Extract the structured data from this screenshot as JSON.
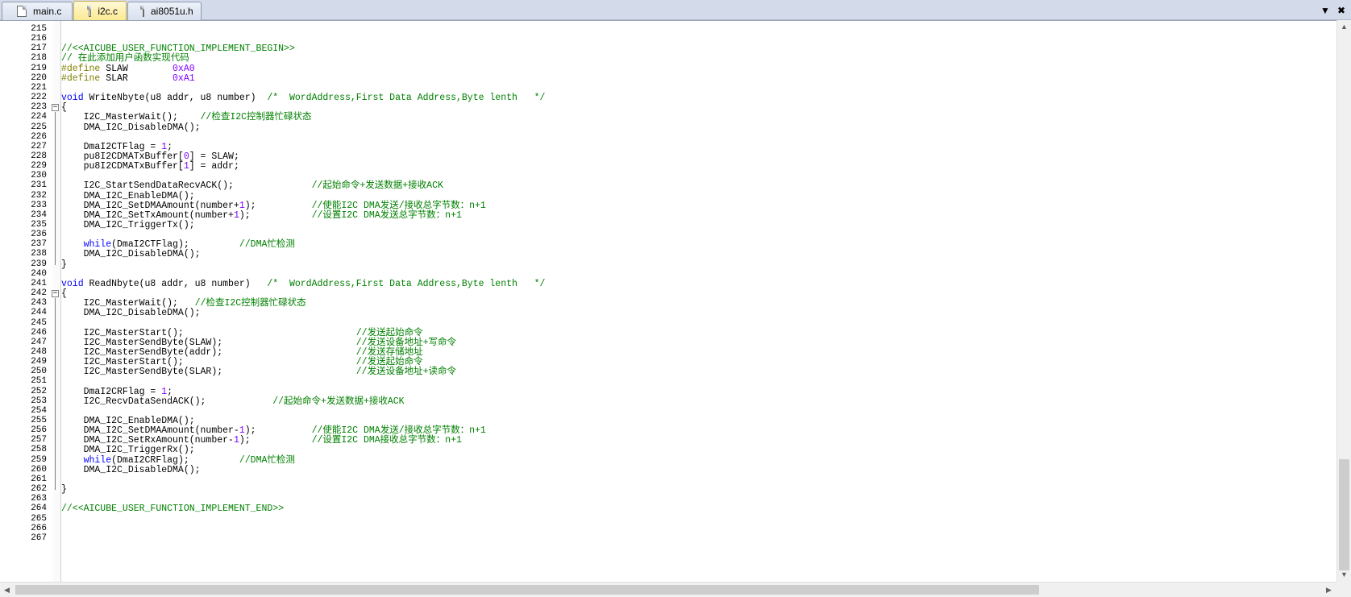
{
  "tabs": [
    {
      "label": "main.c",
      "active": false
    },
    {
      "label": "i2c.c",
      "active": true
    },
    {
      "label": "ai8051u.h",
      "active": false
    }
  ],
  "tab_controls": {
    "dropdown": "▼",
    "close": "✖"
  },
  "scrollbars": {
    "up": "▲",
    "down": "▼",
    "left": "◀",
    "right": "▶"
  },
  "code": [
    {
      "n": "215",
      "tokens": []
    },
    {
      "n": "216",
      "tokens": []
    },
    {
      "n": "217",
      "tokens": [
        [
          "comment",
          "//<<AICUBE_USER_FUNCTION_IMPLEMENT_BEGIN>>"
        ]
      ]
    },
    {
      "n": "218",
      "tokens": [
        [
          "comment",
          "// 在此添加用户函数实现代码"
        ]
      ]
    },
    {
      "n": "219",
      "tokens": [
        [
          "pre",
          "#define"
        ],
        [
          "text",
          " SLAW        "
        ],
        [
          "num",
          "0xA0"
        ]
      ]
    },
    {
      "n": "220",
      "tokens": [
        [
          "pre",
          "#define"
        ],
        [
          "text",
          " SLAR        "
        ],
        [
          "num",
          "0xA1"
        ]
      ]
    },
    {
      "n": "221",
      "tokens": []
    },
    {
      "n": "222",
      "tokens": [
        [
          "keyword",
          "void"
        ],
        [
          "text",
          " WriteNbyte(u8 addr, u8 number)  "
        ],
        [
          "comment",
          "/*  WordAddress,First Data Address,Byte lenth   */"
        ]
      ]
    },
    {
      "n": "223",
      "tokens": [
        [
          "text",
          "{"
        ]
      ],
      "fold": "open"
    },
    {
      "n": "224",
      "tokens": [
        [
          "text",
          "    I2C_MasterWait();    "
        ],
        [
          "comment",
          "//检查I2C控制器忙碌状态"
        ]
      ]
    },
    {
      "n": "225",
      "tokens": [
        [
          "text",
          "    DMA_I2C_DisableDMA();"
        ]
      ]
    },
    {
      "n": "226",
      "tokens": []
    },
    {
      "n": "227",
      "tokens": [
        [
          "text",
          "    DmaI2CTFlag = "
        ],
        [
          "num",
          "1"
        ],
        [
          "text",
          ";"
        ]
      ]
    },
    {
      "n": "228",
      "tokens": [
        [
          "text",
          "    pu8I2CDMATxBuffer["
        ],
        [
          "num",
          "0"
        ],
        [
          "text",
          "] = SLAW;"
        ]
      ]
    },
    {
      "n": "229",
      "tokens": [
        [
          "text",
          "    pu8I2CDMATxBuffer["
        ],
        [
          "num",
          "1"
        ],
        [
          "text",
          "] = addr;"
        ]
      ]
    },
    {
      "n": "230",
      "tokens": []
    },
    {
      "n": "231",
      "tokens": [
        [
          "text",
          "    I2C_StartSendDataRecvACK();              "
        ],
        [
          "comment",
          "//起始命令+发送数据+接收ACK"
        ]
      ]
    },
    {
      "n": "232",
      "tokens": [
        [
          "text",
          "    DMA_I2C_EnableDMA();"
        ]
      ]
    },
    {
      "n": "233",
      "tokens": [
        [
          "text",
          "    DMA_I2C_SetDMAAmount(number+"
        ],
        [
          "num",
          "1"
        ],
        [
          "text",
          ");          "
        ],
        [
          "comment",
          "//使能I2C DMA发送/接收总字节数：n+1"
        ]
      ]
    },
    {
      "n": "234",
      "tokens": [
        [
          "text",
          "    DMA_I2C_SetTxAmount(number+"
        ],
        [
          "num",
          "1"
        ],
        [
          "text",
          ");           "
        ],
        [
          "comment",
          "//设置I2C DMA发送总字节数：n+1"
        ]
      ]
    },
    {
      "n": "235",
      "tokens": [
        [
          "text",
          "    DMA_I2C_TriggerTx();"
        ]
      ]
    },
    {
      "n": "236",
      "tokens": []
    },
    {
      "n": "237",
      "tokens": [
        [
          "keyword",
          "    while"
        ],
        [
          "text",
          "(DmaI2CTFlag);         "
        ],
        [
          "comment",
          "//DMA忙检测"
        ]
      ]
    },
    {
      "n": "238",
      "tokens": [
        [
          "text",
          "    DMA_I2C_DisableDMA();"
        ]
      ]
    },
    {
      "n": "239",
      "tokens": [
        [
          "text",
          "}"
        ]
      ]
    },
    {
      "n": "240",
      "tokens": []
    },
    {
      "n": "241",
      "tokens": [
        [
          "keyword",
          "void"
        ],
        [
          "text",
          " ReadNbyte(u8 addr, u8 number)   "
        ],
        [
          "comment",
          "/*  WordAddress,First Data Address,Byte lenth   */"
        ]
      ]
    },
    {
      "n": "242",
      "tokens": [
        [
          "text",
          "{"
        ]
      ],
      "fold": "open"
    },
    {
      "n": "243",
      "tokens": [
        [
          "text",
          "    I2C_MasterWait();   "
        ],
        [
          "comment",
          "//检查I2C控制器忙碌状态"
        ]
      ]
    },
    {
      "n": "244",
      "tokens": [
        [
          "text",
          "    DMA_I2C_DisableDMA();"
        ]
      ]
    },
    {
      "n": "245",
      "tokens": []
    },
    {
      "n": "246",
      "tokens": [
        [
          "text",
          "    I2C_MasterStart();                               "
        ],
        [
          "comment",
          "//发送起始命令"
        ]
      ]
    },
    {
      "n": "247",
      "tokens": [
        [
          "text",
          "    I2C_MasterSendByte(SLAW);                        "
        ],
        [
          "comment",
          "//发送设备地址+写命令"
        ]
      ]
    },
    {
      "n": "248",
      "tokens": [
        [
          "text",
          "    I2C_MasterSendByte(addr);                        "
        ],
        [
          "comment",
          "//发送存储地址"
        ]
      ]
    },
    {
      "n": "249",
      "tokens": [
        [
          "text",
          "    I2C_MasterStart();                               "
        ],
        [
          "comment",
          "//发送起始命令"
        ]
      ]
    },
    {
      "n": "250",
      "tokens": [
        [
          "text",
          "    I2C_MasterSendByte(SLAR);                        "
        ],
        [
          "comment",
          "//发送设备地址+读命令"
        ]
      ]
    },
    {
      "n": "251",
      "tokens": []
    },
    {
      "n": "252",
      "tokens": [
        [
          "text",
          "    DmaI2CRFlag = "
        ],
        [
          "num",
          "1"
        ],
        [
          "text",
          ";"
        ]
      ]
    },
    {
      "n": "253",
      "tokens": [
        [
          "text",
          "    I2C_RecvDataSendACK();            "
        ],
        [
          "comment",
          "//起始命令+发送数据+接收ACK"
        ]
      ]
    },
    {
      "n": "254",
      "tokens": []
    },
    {
      "n": "255",
      "tokens": [
        [
          "text",
          "    DMA_I2C_EnableDMA();"
        ]
      ]
    },
    {
      "n": "256",
      "tokens": [
        [
          "text",
          "    DMA_I2C_SetDMAAmount(number-"
        ],
        [
          "num",
          "1"
        ],
        [
          "text",
          ");          "
        ],
        [
          "comment",
          "//使能I2C DMA发送/接收总字节数：n+1"
        ]
      ]
    },
    {
      "n": "257",
      "tokens": [
        [
          "text",
          "    DMA_I2C_SetRxAmount(number-"
        ],
        [
          "num",
          "1"
        ],
        [
          "text",
          ");           "
        ],
        [
          "comment",
          "//设置I2C DMA接收总字节数：n+1"
        ]
      ]
    },
    {
      "n": "258",
      "tokens": [
        [
          "text",
          "    DMA_I2C_TriggerRx();"
        ]
      ]
    },
    {
      "n": "259",
      "tokens": [
        [
          "keyword",
          "    while"
        ],
        [
          "text",
          "(DmaI2CRFlag);         "
        ],
        [
          "comment",
          "//DMA忙检测"
        ]
      ]
    },
    {
      "n": "260",
      "tokens": [
        [
          "text",
          "    DMA_I2C_DisableDMA();"
        ]
      ]
    },
    {
      "n": "261",
      "tokens": []
    },
    {
      "n": "262",
      "tokens": [
        [
          "text",
          "}"
        ]
      ]
    },
    {
      "n": "263",
      "tokens": []
    },
    {
      "n": "264",
      "tokens": [
        [
          "comment",
          "//<<AICUBE_USER_FUNCTION_IMPLEMENT_END>>"
        ]
      ]
    },
    {
      "n": "265",
      "tokens": []
    },
    {
      "n": "266",
      "tokens": []
    },
    {
      "n": "267",
      "tokens": []
    }
  ]
}
